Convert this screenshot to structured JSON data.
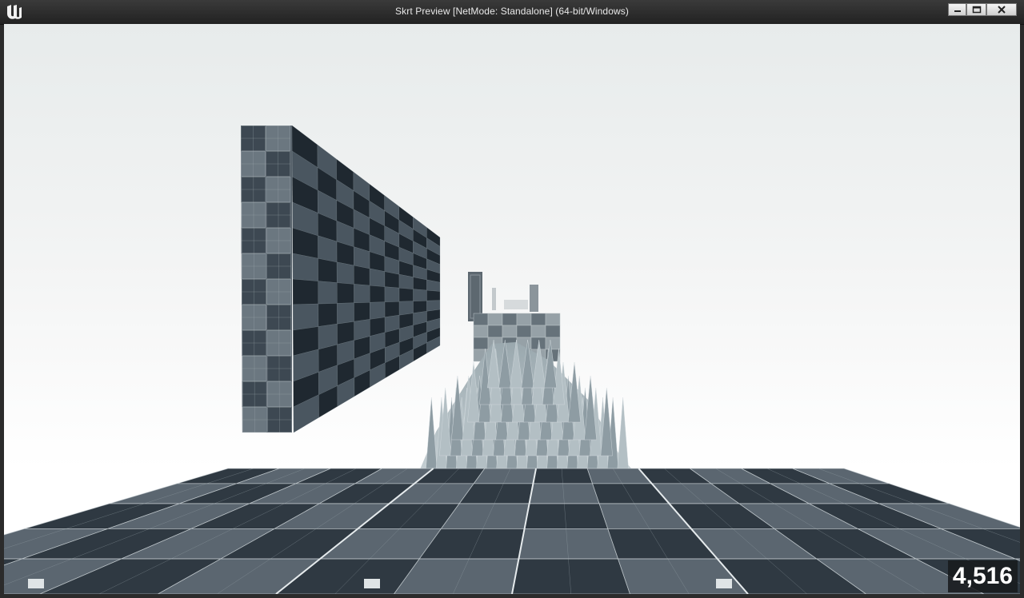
{
  "window": {
    "title": "Skrt Preview [NetMode: Standalone] (64-bit/Windows)",
    "logo_icon": "unreal-engine-logo-icon",
    "controls": [
      "minimize-icon",
      "maximize-icon",
      "close-icon"
    ]
  },
  "viewport": {
    "counter": "4,516",
    "scene_objects": [
      "checker-wall",
      "spike-field",
      "grid-tower",
      "checker-floor"
    ],
    "colors": {
      "sky": "#eef0f0",
      "checker_dark": "#2f3942",
      "checker_light": "#5b6670",
      "spikes": "#a9b5bb",
      "counter_bg": "#181a1c"
    }
  }
}
